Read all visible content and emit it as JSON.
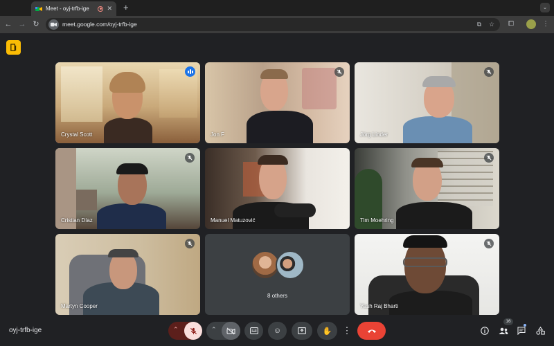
{
  "browser": {
    "tab_title": "Meet - oyj-trfb-ige",
    "new_tab_symbol": "+",
    "url": "meet.google.com/oyj-trfb-ige"
  },
  "participants": [
    {
      "name": "Crystal Scott",
      "speaking": true,
      "muted": false
    },
    {
      "name": "Jon F",
      "speaking": false,
      "muted": true
    },
    {
      "name": "Jörg Linder",
      "speaking": false,
      "muted": true
    },
    {
      "name": "Cristian Díaz",
      "speaking": false,
      "muted": true
    },
    {
      "name": "Manuel Matuzović",
      "speaking": false,
      "muted": false
    },
    {
      "name": "Tim Moehring",
      "speaking": false,
      "muted": true
    },
    {
      "name": "Martyn Cooper",
      "speaking": false,
      "muted": true
    },
    {
      "name": "Yash Raj Bharti",
      "speaking": false,
      "muted": true
    }
  ],
  "others_tile": {
    "label": "8 others"
  },
  "meeting": {
    "code": "oyj-trfb-ige",
    "people_count": "16"
  },
  "colors": {
    "accent": "#8ab4f8",
    "speaking": "#1a73e8",
    "end_call": "#ea4335",
    "badge": "#fbbc04"
  }
}
